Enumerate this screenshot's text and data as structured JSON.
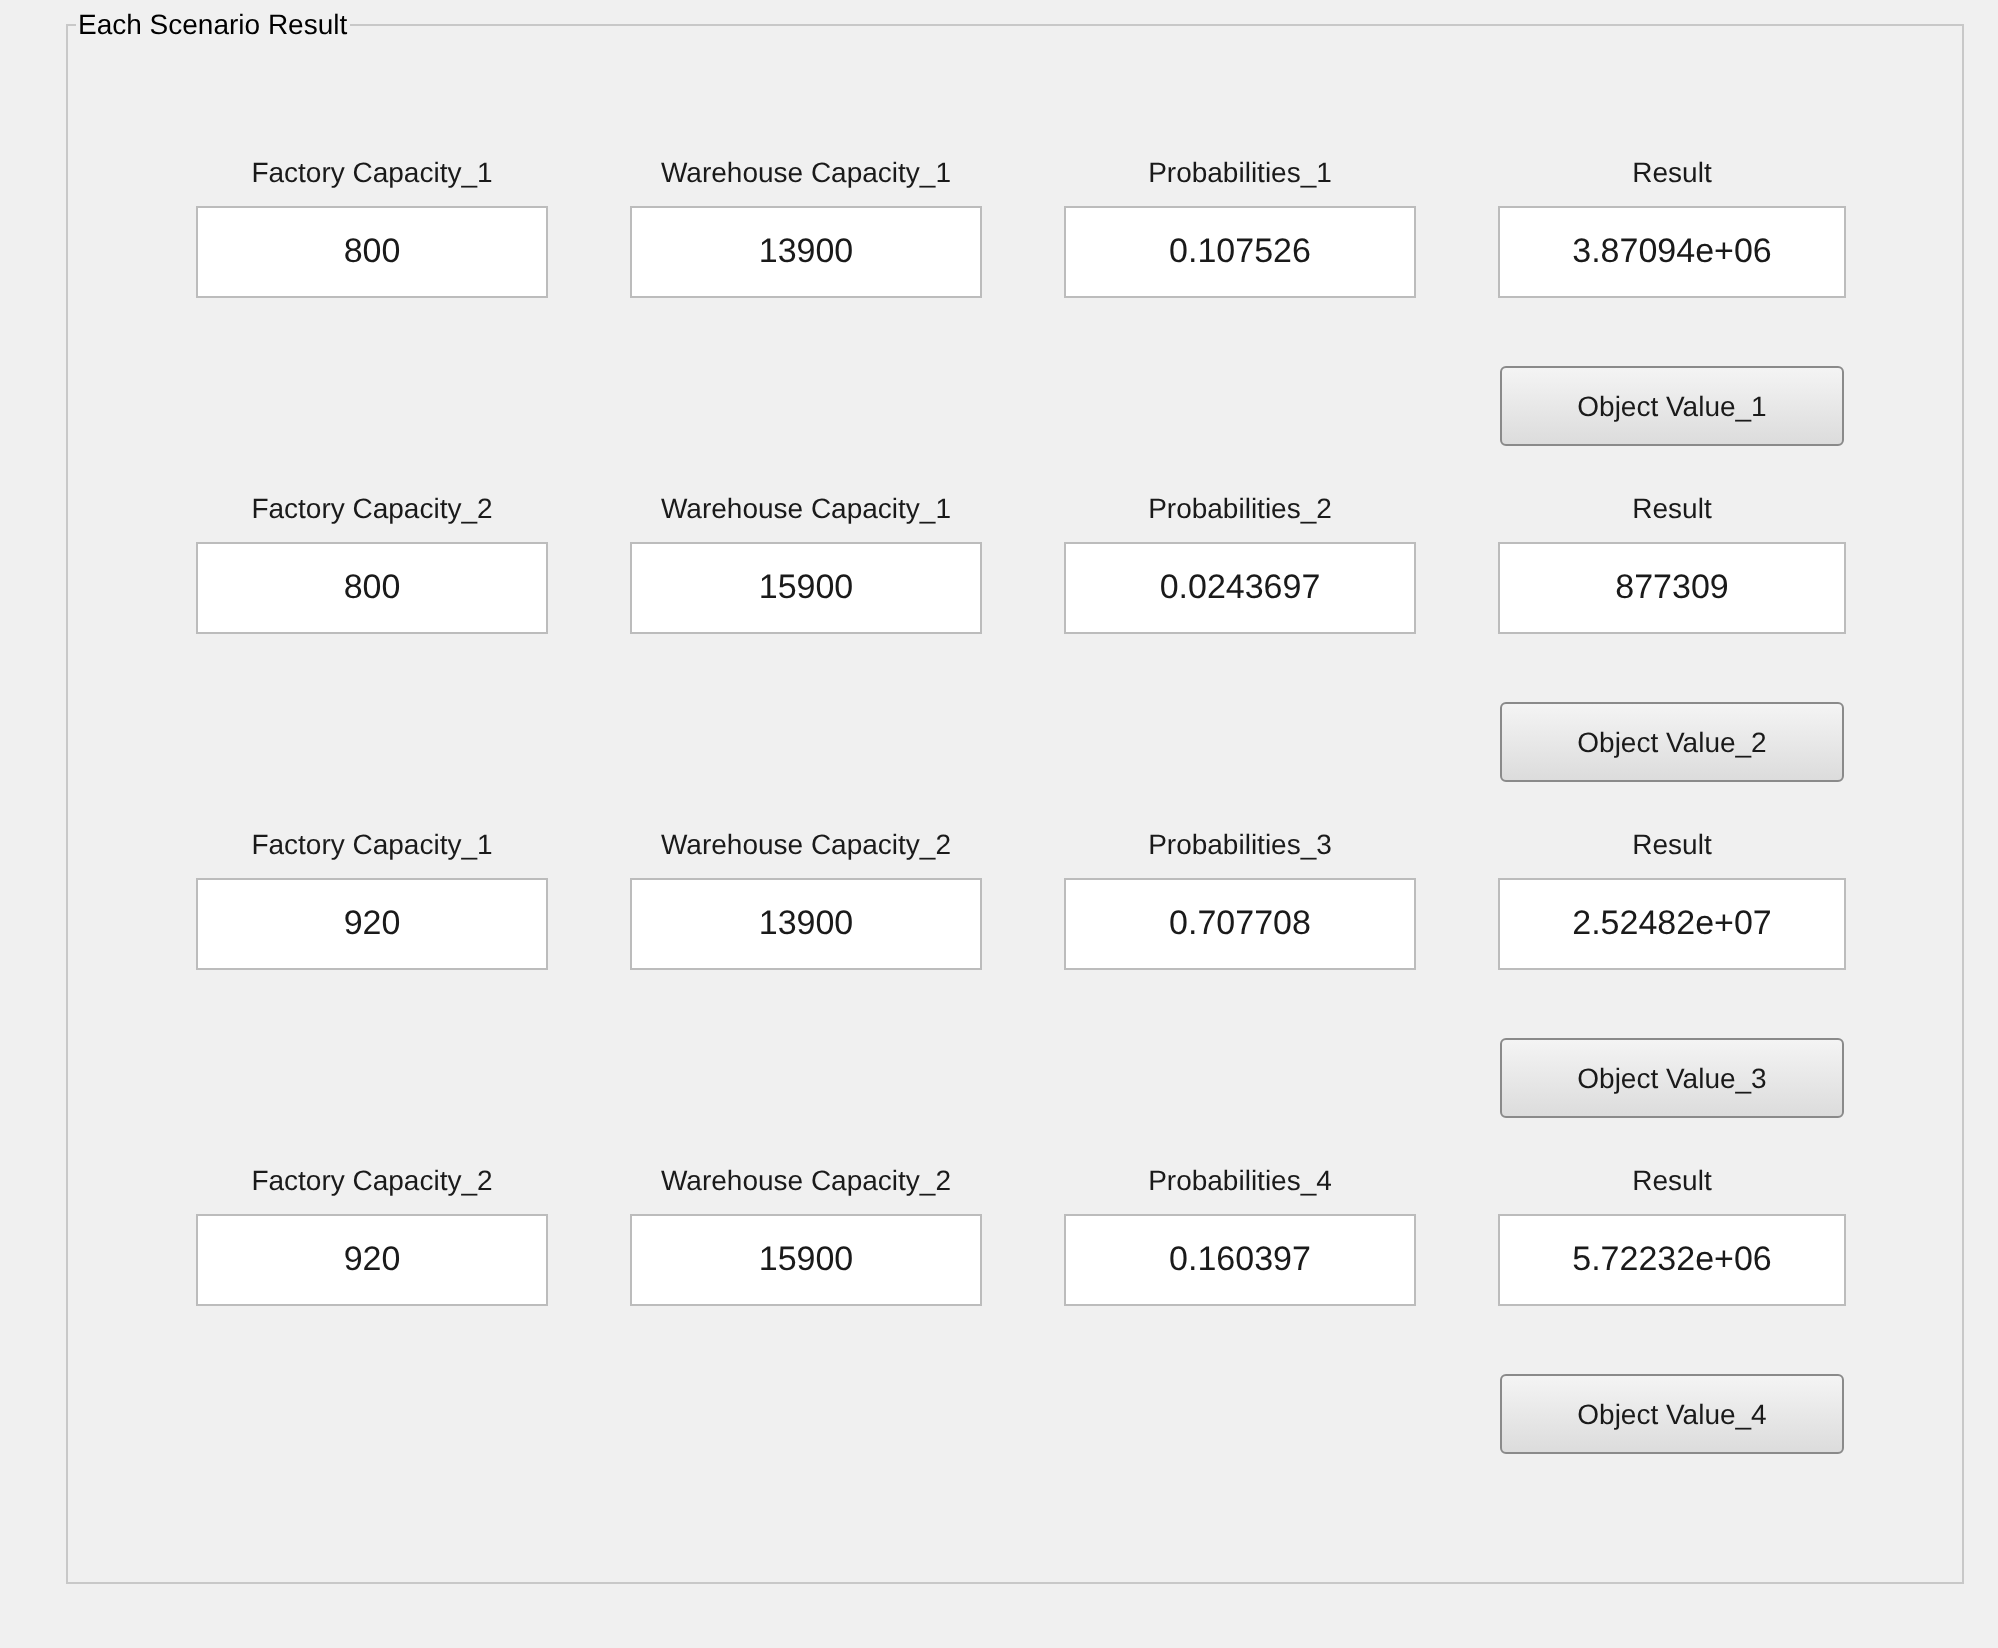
{
  "panel": {
    "title": "Each Scenario Result"
  },
  "scenarios": [
    {
      "fields": [
        {
          "label": "Factory Capacity_1",
          "value": "800"
        },
        {
          "label": "Warehouse Capacity_1",
          "value": "13900"
        },
        {
          "label": "Probabilities_1",
          "value": "0.107526"
        },
        {
          "label": "Result",
          "value": "3.87094e+06"
        }
      ],
      "button": "Object Value_1"
    },
    {
      "fields": [
        {
          "label": "Factory Capacity_2",
          "value": "800"
        },
        {
          "label": "Warehouse Capacity_1",
          "value": "15900"
        },
        {
          "label": "Probabilities_2",
          "value": "0.0243697"
        },
        {
          "label": "Result",
          "value": "877309"
        }
      ],
      "button": "Object Value_2"
    },
    {
      "fields": [
        {
          "label": "Factory Capacity_1",
          "value": "920"
        },
        {
          "label": "Warehouse Capacity_2",
          "value": "13900"
        },
        {
          "label": "Probabilities_3",
          "value": "0.707708"
        },
        {
          "label": "Result",
          "value": "2.52482e+07"
        }
      ],
      "button": "Object Value_3"
    },
    {
      "fields": [
        {
          "label": "Factory Capacity_2",
          "value": "920"
        },
        {
          "label": "Warehouse Capacity_2",
          "value": "15900"
        },
        {
          "label": "Probabilities_4",
          "value": "0.160397"
        },
        {
          "label": "Result",
          "value": "5.72232e+06"
        }
      ],
      "button": "Object Value_4"
    }
  ]
}
